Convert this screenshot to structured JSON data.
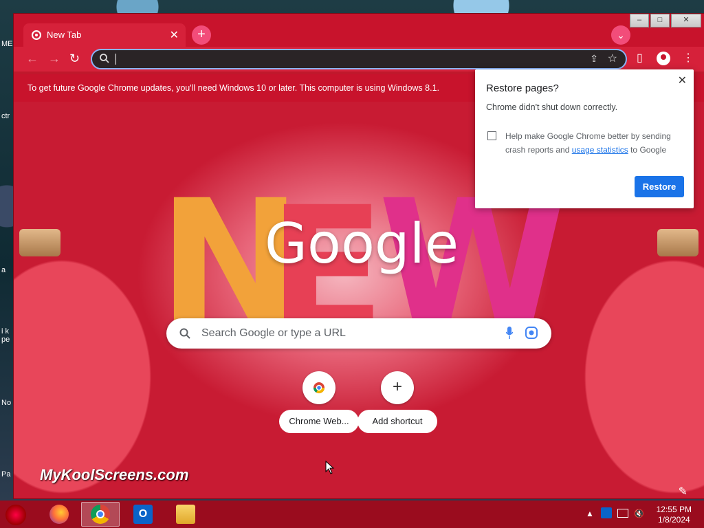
{
  "desktop": {
    "labels": [
      "ME",
      "ctr",
      "a",
      "i k pe",
      "No",
      "Pa"
    ]
  },
  "tab": {
    "title": "New Tab",
    "close_icon": "close-icon"
  },
  "window_controls": {
    "minimize": "–",
    "maximize": "□",
    "close": "✕"
  },
  "toolbar": {
    "back_icon": "←",
    "forward_icon": "→",
    "reload_icon": "↻",
    "omnibox_value": "",
    "share_icon": "⇪",
    "star_icon": "☆",
    "sidepanel_icon": "▯",
    "menu_icon": "⋮"
  },
  "infobar": {
    "text": "To get future Google Chrome updates, you'll need Windows 10 or later. This computer is using Windows 8.1."
  },
  "ntp": {
    "logo": "Google",
    "search_placeholder": "Search Google or type a URL",
    "shortcuts": [
      {
        "label": "Chrome Web...",
        "icon": "chrome-icon"
      },
      {
        "label": "Add shortcut",
        "icon": "+"
      }
    ],
    "watermark": "MyKoolScreens.com",
    "customize_icon": "✎"
  },
  "restore_popup": {
    "title": "Restore pages?",
    "message": "Chrome didn't shut down correctly.",
    "checkbox_prefix": "Help make Google Chrome better by sending crash reports and ",
    "checkbox_link": "usage statistics",
    "checkbox_suffix": " to Google",
    "restore_button": "Restore",
    "close": "✕"
  },
  "taskbar": {
    "apps": [
      "firefox",
      "chrome",
      "outlook",
      "file-explorer"
    ],
    "tray_arrow": "▲",
    "time": "12:55 PM",
    "date": "1/8/2024"
  },
  "colors": {
    "chrome_frame": "#c8132c",
    "accent_blue": "#1a73e8"
  }
}
